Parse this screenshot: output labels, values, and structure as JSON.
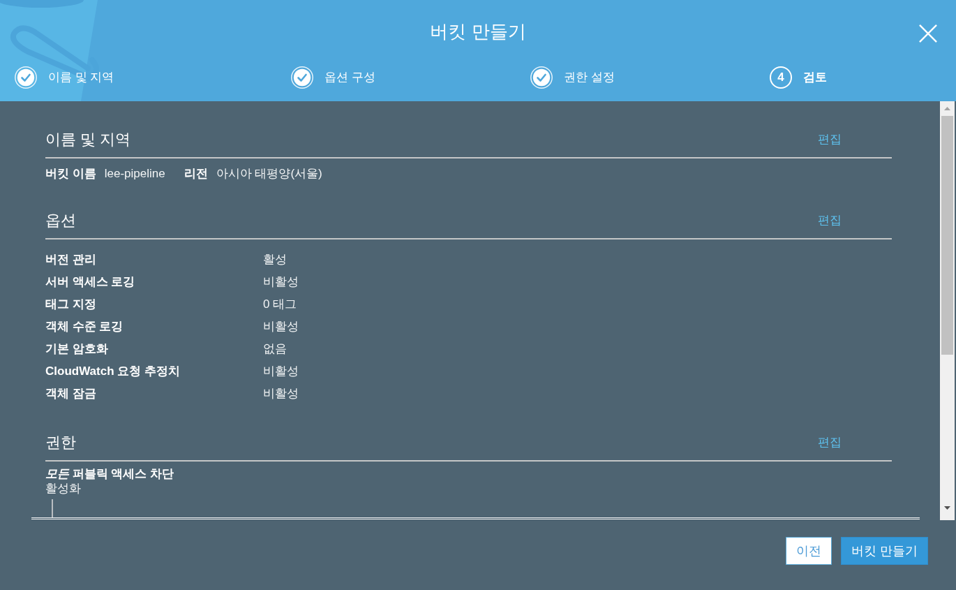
{
  "dialog": {
    "title": "버킷 만들기"
  },
  "steps": [
    {
      "label": "이름 및 지역",
      "completed": true,
      "selected": false
    },
    {
      "label": "옵션 구성",
      "completed": true,
      "selected": false
    },
    {
      "label": "권한 설정",
      "completed": true,
      "selected": false
    },
    {
      "label": "검토",
      "number": "4",
      "completed": false,
      "selected": true
    }
  ],
  "sections": [
    {
      "title": "이름 및 지역",
      "edit_link": "편집",
      "kind": "inline",
      "fields": [
        {
          "label": "버킷 이름",
          "value": "lee-pipeline"
        },
        {
          "label": "리전",
          "value": "아시아 태평양(서울)"
        }
      ]
    },
    {
      "title": "옵션",
      "edit_link": "편집",
      "kind": "table",
      "fields": [
        {
          "label": "버전 관리",
          "value": "활성"
        },
        {
          "label": "서버 액세스 로깅",
          "value": "비활성"
        },
        {
          "label": "태그 지정",
          "value": "0 태그"
        },
        {
          "label": "객체 수준 로깅",
          "value": "비활성"
        },
        {
          "label": "기본 암호화",
          "value": "없음"
        },
        {
          "label": "CloudWatch 요청 추정치",
          "value": "비활성"
        },
        {
          "label": "객체 잠금",
          "value": "비활성"
        }
      ]
    },
    {
      "title": "권한",
      "edit_link": "편집",
      "kind": "stacked",
      "fields": [
        {
          "label": "*모든* 퍼블릭 액세스 차단",
          "value": "활성화"
        }
      ]
    }
  ],
  "buttons": [
    {
      "label": "이전",
      "kind": "secondary"
    },
    {
      "label": "버킷 만들기",
      "kind": "primary"
    }
  ]
}
